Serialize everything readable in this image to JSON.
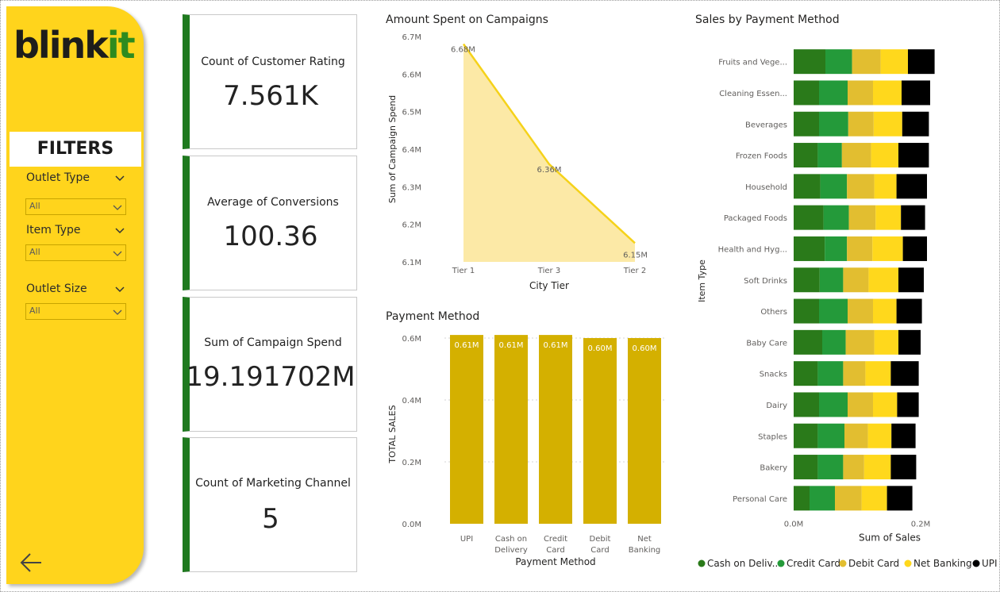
{
  "brand": {
    "logo_text_1": "blink",
    "logo_text_2": "it",
    "logo_color_dark": "#1d1d1b",
    "logo_color_green": "#2e8b1f"
  },
  "sidebar": {
    "background": "#FFD41C",
    "filters_title": "FILTERS",
    "filters": [
      {
        "label": "Outlet Type",
        "value": "All"
      },
      {
        "label": "Item Type",
        "value": "All"
      },
      {
        "label": "Outlet Size",
        "value": "All"
      }
    ],
    "back_icon": "arrow-left-icon"
  },
  "kpis": [
    {
      "label": "Count of Customer Rating",
      "value": "7.561K"
    },
    {
      "label": "Average of Conversions",
      "value": "100.36"
    },
    {
      "label": "Sum of Campaign Spend",
      "value": "19.191702M"
    },
    {
      "label": "Count of Marketing Channel",
      "value": "5"
    }
  ],
  "chart_data": [
    {
      "type": "area",
      "title": "Amount Spent on Campaigns",
      "xlabel": "City Tier",
      "ylabel": "Sum of Campaign Spend",
      "categories": [
        "Tier 1",
        "Tier 3",
        "Tier 2"
      ],
      "values": [
        6.68,
        6.36,
        6.15
      ],
      "data_labels": [
        "6.68M",
        "6.36M",
        "6.15M"
      ],
      "ylim": [
        6.1,
        6.7
      ],
      "yticks": [
        "6.1M",
        "6.2M",
        "6.3M",
        "6.4M",
        "6.5M",
        "6.6M",
        "6.7M"
      ],
      "color": "#F5D21A",
      "grid": false
    },
    {
      "type": "bar",
      "title": "Payment Method",
      "xlabel": "Payment Method",
      "ylabel": "TOTAL SALES",
      "categories": [
        "UPI",
        "Cash on Delivery",
        "Credit Card",
        "Debit Card",
        "Net Banking"
      ],
      "category_lines": [
        [
          "UPI"
        ],
        [
          "Cash on",
          "Delivery"
        ],
        [
          "Credit",
          "Card"
        ],
        [
          "Debit",
          "Card"
        ],
        [
          "Net",
          "Banking"
        ]
      ],
      "values": [
        0.61,
        0.61,
        0.61,
        0.6,
        0.6
      ],
      "data_labels": [
        "0.61M",
        "0.61M",
        "0.61M",
        "0.60M",
        "0.60M"
      ],
      "ylim": [
        0,
        0.6
      ],
      "yticks": [
        "0.0M",
        "0.2M",
        "0.4M",
        "0.6M"
      ],
      "color": "#D4B000",
      "grid": true
    },
    {
      "type": "bar",
      "orientation": "horizontal",
      "stacked": true,
      "title": "Sales by Payment Method",
      "xlabel": "Sum of Sales",
      "ylabel": "Item Type",
      "categories": [
        "Fruits and Vege...",
        "Cleaning Essen...",
        "Beverages",
        "Frozen Foods",
        "Household",
        "Packaged Foods",
        "Health and Hyg...",
        "Soft Drinks",
        "Others",
        "Baby Care",
        "Snacks",
        "Dairy",
        "Staples",
        "Bakery",
        "Personal Care"
      ],
      "xlim": [
        0,
        0.2
      ],
      "xticks": [
        "0.0M",
        "0.2M"
      ],
      "legend_position": "bottom",
      "series": [
        {
          "name": "Cash on Deliv...",
          "color": "#2a7a1a",
          "values": [
            0.05,
            0.04,
            0.04,
            0.038,
            0.042,
            0.047,
            0.049,
            0.041,
            0.04,
            0.045,
            0.038,
            0.04,
            0.038,
            0.038,
            0.025
          ]
        },
        {
          "name": "Credit Card",
          "color": "#249a3a",
          "values": [
            0.042,
            0.045,
            0.046,
            0.038,
            0.042,
            0.04,
            0.035,
            0.037,
            0.045,
            0.037,
            0.04,
            0.045,
            0.042,
            0.04,
            0.04
          ]
        },
        {
          "name": "Debit Card",
          "color": "#E2BE30",
          "values": [
            0.045,
            0.04,
            0.04,
            0.046,
            0.043,
            0.042,
            0.04,
            0.04,
            0.04,
            0.045,
            0.035,
            0.04,
            0.037,
            0.033,
            0.042
          ]
        },
        {
          "name": "Net Banking",
          "color": "#FFD81C",
          "values": [
            0.043,
            0.045,
            0.045,
            0.043,
            0.035,
            0.04,
            0.048,
            0.047,
            0.037,
            0.038,
            0.04,
            0.038,
            0.037,
            0.042,
            0.04
          ]
        },
        {
          "name": "UPI",
          "color": "#000000",
          "values": [
            0.042,
            0.045,
            0.042,
            0.048,
            0.048,
            0.038,
            0.038,
            0.04,
            0.04,
            0.035,
            0.044,
            0.034,
            0.038,
            0.04,
            0.04
          ]
        }
      ]
    }
  ]
}
